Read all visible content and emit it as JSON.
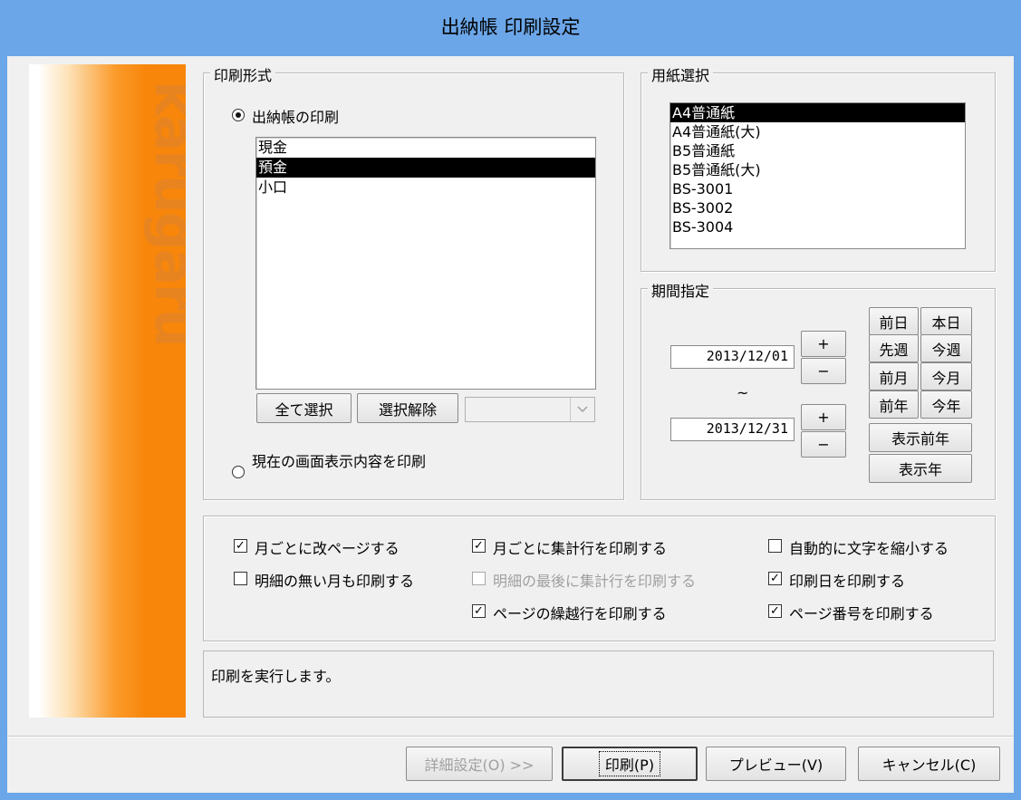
{
  "window": {
    "title": "出納帳 印刷設定"
  },
  "logo": {
    "text": "karugaru"
  },
  "print_format": {
    "label": "印刷形式",
    "radio_ledger": "出納帳の印刷",
    "radio_screen": "現在の画面表示内容を印刷",
    "selected_radio": "ledger",
    "accounts": [
      {
        "label": "現金",
        "selected": false
      },
      {
        "label": "預金",
        "selected": true
      },
      {
        "label": "小口",
        "selected": false
      }
    ],
    "select_all_button": "全て選択",
    "deselect_button": "選択解除",
    "combo_value": ""
  },
  "paper": {
    "label": "用紙選択",
    "items": [
      {
        "label": "A4普通紙",
        "selected": true
      },
      {
        "label": "A4普通紙(大)",
        "selected": false
      },
      {
        "label": "B5普通紙",
        "selected": false
      },
      {
        "label": "B5普通紙(大)",
        "selected": false
      },
      {
        "label": "BS-3001",
        "selected": false
      },
      {
        "label": "BS-3002",
        "selected": false
      },
      {
        "label": "BS-3004",
        "selected": false
      }
    ]
  },
  "period": {
    "label": "期間指定",
    "from_date": "2013/12/01",
    "to_date": "2013/12/31",
    "range_separator": "~",
    "plus": "+",
    "minus": "−",
    "buttons": {
      "prev_day": "前日",
      "today": "本日",
      "last_week": "先週",
      "this_week": "今週",
      "last_month": "前月",
      "this_month": "今月",
      "last_year": "前年",
      "this_year": "今年",
      "display_prev_year": "表示前年",
      "display_year": "表示年"
    }
  },
  "options": [
    {
      "key": "page_break_month",
      "label": "月ごとに改ページする",
      "checked": true,
      "enabled": true
    },
    {
      "key": "monthly_total",
      "label": "月ごとに集計行を印刷する",
      "checked": true,
      "enabled": true
    },
    {
      "key": "auto_shrink",
      "label": "自動的に文字を縮小する",
      "checked": false,
      "enabled": true
    },
    {
      "key": "print_empty_month",
      "label": "明細の無い月も印刷する",
      "checked": false,
      "enabled": true
    },
    {
      "key": "total_at_end",
      "label": "明細の最後に集計行を印刷する",
      "checked": false,
      "enabled": false
    },
    {
      "key": "print_date",
      "label": "印刷日を印刷する",
      "checked": true,
      "enabled": true
    },
    {
      "key": "carry_over",
      "label": "ページの繰越行を印刷する",
      "checked": true,
      "enabled": true
    },
    {
      "key": "page_number",
      "label": "ページ番号を印刷する",
      "checked": true,
      "enabled": true
    }
  ],
  "status_message": "印刷を実行します。",
  "footer": {
    "detail_button": "詳細設定(O) >>",
    "print_button": "印刷(P)",
    "preview_button": "プレビュー(V)",
    "cancel_button": "キャンセル(C)"
  }
}
